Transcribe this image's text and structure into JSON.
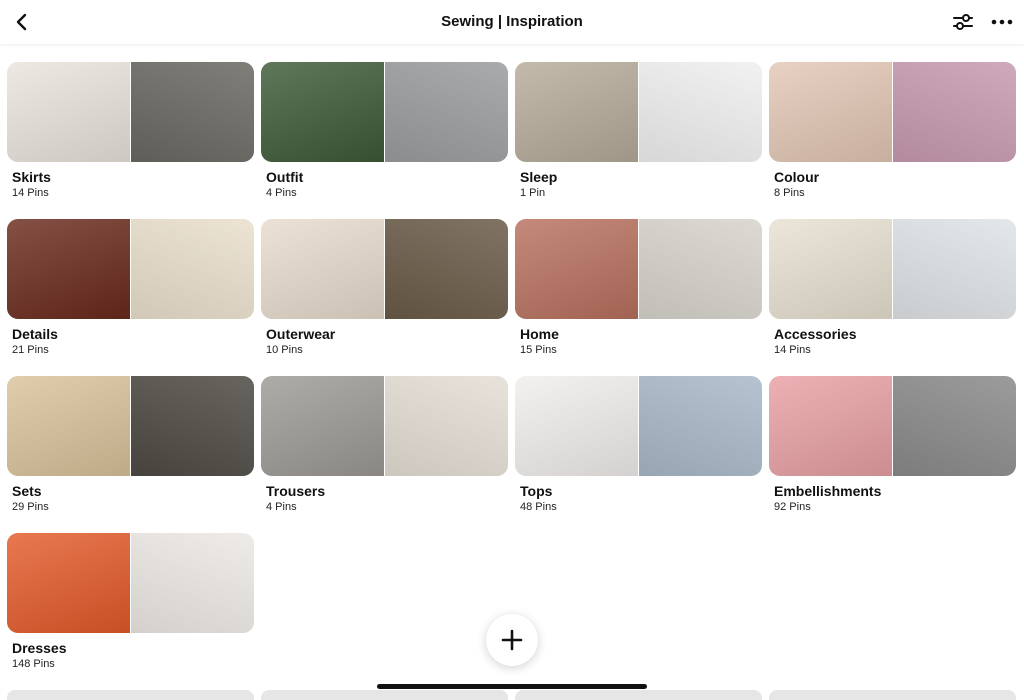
{
  "header": {
    "title": "Sewing | Inspiration"
  },
  "icons": {
    "back": "chevron-left-icon",
    "filter": "sliders-icon",
    "more": "more-horizontal-icon",
    "add": "plus-icon"
  },
  "boards": [
    {
      "name": "Skirts",
      "count": "14 Pins",
      "colors": [
        "#e9e4dc",
        "#6b6862"
      ]
    },
    {
      "name": "Outfit",
      "count": "4 Pins",
      "colors": [
        "#3d5a36",
        "#9a9c9e"
      ]
    },
    {
      "name": "Sleep",
      "count": "1 Pin",
      "colors": [
        "#b6ab9a",
        "#efefef"
      ]
    },
    {
      "name": "Colour",
      "count": "8 Pins",
      "colors": [
        "#e3c7b5",
        "#c79ab0"
      ]
    },
    {
      "name": "Details",
      "count": "21 Pins",
      "colors": [
        "#6a2a1c",
        "#e9dfcc"
      ]
    },
    {
      "name": "Outerwear",
      "count": "10 Pins",
      "colors": [
        "#e7dbcd",
        "#6a5b48"
      ]
    },
    {
      "name": "Home",
      "count": "15 Pins",
      "colors": [
        "#b8705e",
        "#d7d3cc"
      ]
    },
    {
      "name": "Accessories",
      "count": "14 Pins",
      "colors": [
        "#e8e1d2",
        "#dfe3e6"
      ]
    },
    {
      "name": "Sets",
      "count": "29 Pins",
      "colors": [
        "#d9c29a",
        "#4e4a44"
      ]
    },
    {
      "name": "Trousers",
      "count": "4 Pins",
      "colors": [
        "#9d9a95",
        "#e4ded4"
      ]
    },
    {
      "name": "Tops",
      "count": "48 Pins",
      "colors": [
        "#f1eeec",
        "#a9b8c8"
      ]
    },
    {
      "name": "Embellishments",
      "count": "92 Pins",
      "colors": [
        "#e8a0a4",
        "#8a8a8a"
      ]
    },
    {
      "name": "Dresses",
      "count": "148 Pins",
      "colors": [
        "#e35a2a",
        "#ece8e4"
      ]
    }
  ]
}
